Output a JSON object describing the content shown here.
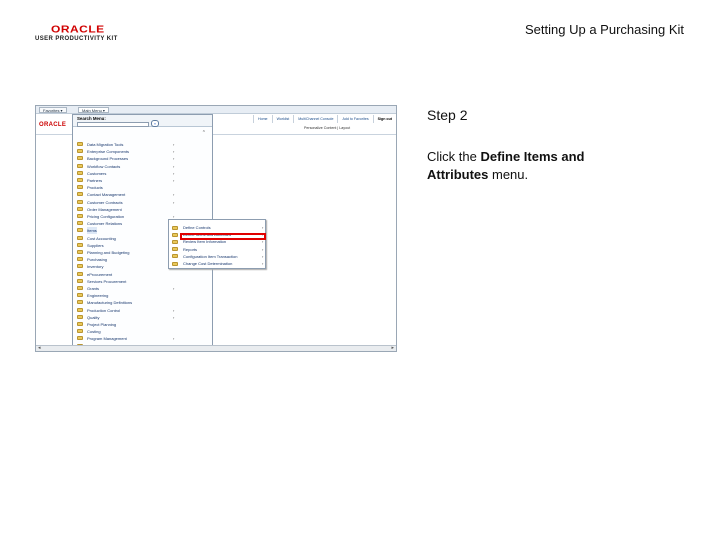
{
  "header": {
    "logo_word": "ORACLE",
    "logo_sub": "USER PRODUCTIVITY KIT",
    "slide_title": "Setting Up a Purchasing Kit"
  },
  "screenshot": {
    "tabs": [
      "Favorites ▾",
      "Main Menu ▾"
    ],
    "mini_logo": "ORACLE",
    "nav_links": [
      "Home",
      "Worklist",
      "MultiChannel Console",
      "Add to Favorites",
      "Sign out"
    ],
    "personalize": "Personalize Content | Layout",
    "menu_title": "Search Menu:",
    "search_button": "»",
    "collapse_icon": "⌃",
    "menu_items": [
      {
        "label": "Data Migration Tools",
        "arrow": "›"
      },
      {
        "label": "Enterprise Components",
        "arrow": "›"
      },
      {
        "label": "Background Processes",
        "arrow": "›"
      },
      {
        "label": "Workflow Contacts",
        "arrow": "›"
      },
      {
        "label": "Customers",
        "arrow": "›"
      },
      {
        "label": "Partners",
        "arrow": "›"
      },
      {
        "label": "Products",
        "arrow": ""
      },
      {
        "label": "Contact Management",
        "arrow": "›"
      },
      {
        "label": "Customer Contracts",
        "arrow": "›"
      },
      {
        "label": "Order Management",
        "arrow": ""
      },
      {
        "label": "Pricing Configuration",
        "arrow": "›"
      },
      {
        "label": "Customer Relations",
        "arrow": ""
      },
      {
        "label": "Items",
        "arrow": "›"
      },
      {
        "label": "Cost Accounting",
        "arrow": "›"
      },
      {
        "label": "Suppliers",
        "arrow": "›"
      },
      {
        "label": "Planning and Budgeting",
        "arrow": "›"
      },
      {
        "label": "Purchasing",
        "arrow": "›"
      },
      {
        "label": "Inventory",
        "arrow": "›"
      },
      {
        "label": "eProcurement",
        "arrow": ""
      },
      {
        "label": "Services Procurement",
        "arrow": ""
      },
      {
        "label": "Grants",
        "arrow": "›"
      },
      {
        "label": "Engineering",
        "arrow": ""
      },
      {
        "label": "Manufacturing Definitions",
        "arrow": ""
      },
      {
        "label": "Production Control",
        "arrow": "›"
      },
      {
        "label": "Quality",
        "arrow": "›"
      },
      {
        "label": "Project Planning",
        "arrow": ""
      },
      {
        "label": "Costing",
        "arrow": ""
      },
      {
        "label": "Program Management",
        "arrow": "›"
      },
      {
        "label": "Project Costing",
        "arrow": "›"
      }
    ],
    "submenu_items": [
      {
        "label": "Define Controls",
        "arrow": "›"
      },
      {
        "label": "Define Items and Attributes",
        "arrow": "›"
      },
      {
        "label": "Review Item Information",
        "arrow": "›"
      },
      {
        "label": "Reports",
        "arrow": "›"
      },
      {
        "label": "Configuration Item Transaction",
        "arrow": "›"
      },
      {
        "label": "Change Cost Determination",
        "arrow": "›"
      }
    ],
    "scroll_left": "◂",
    "scroll_right": "▸"
  },
  "step": {
    "label": "Step 2",
    "instruction_prefix": "Click the ",
    "instruction_bold": "Define Items and Attributes",
    "instruction_suffix": " menu."
  },
  "colors": {
    "oracle_red": "#d00000",
    "highlight_red": "#e00000",
    "link_blue": "#14346b"
  }
}
